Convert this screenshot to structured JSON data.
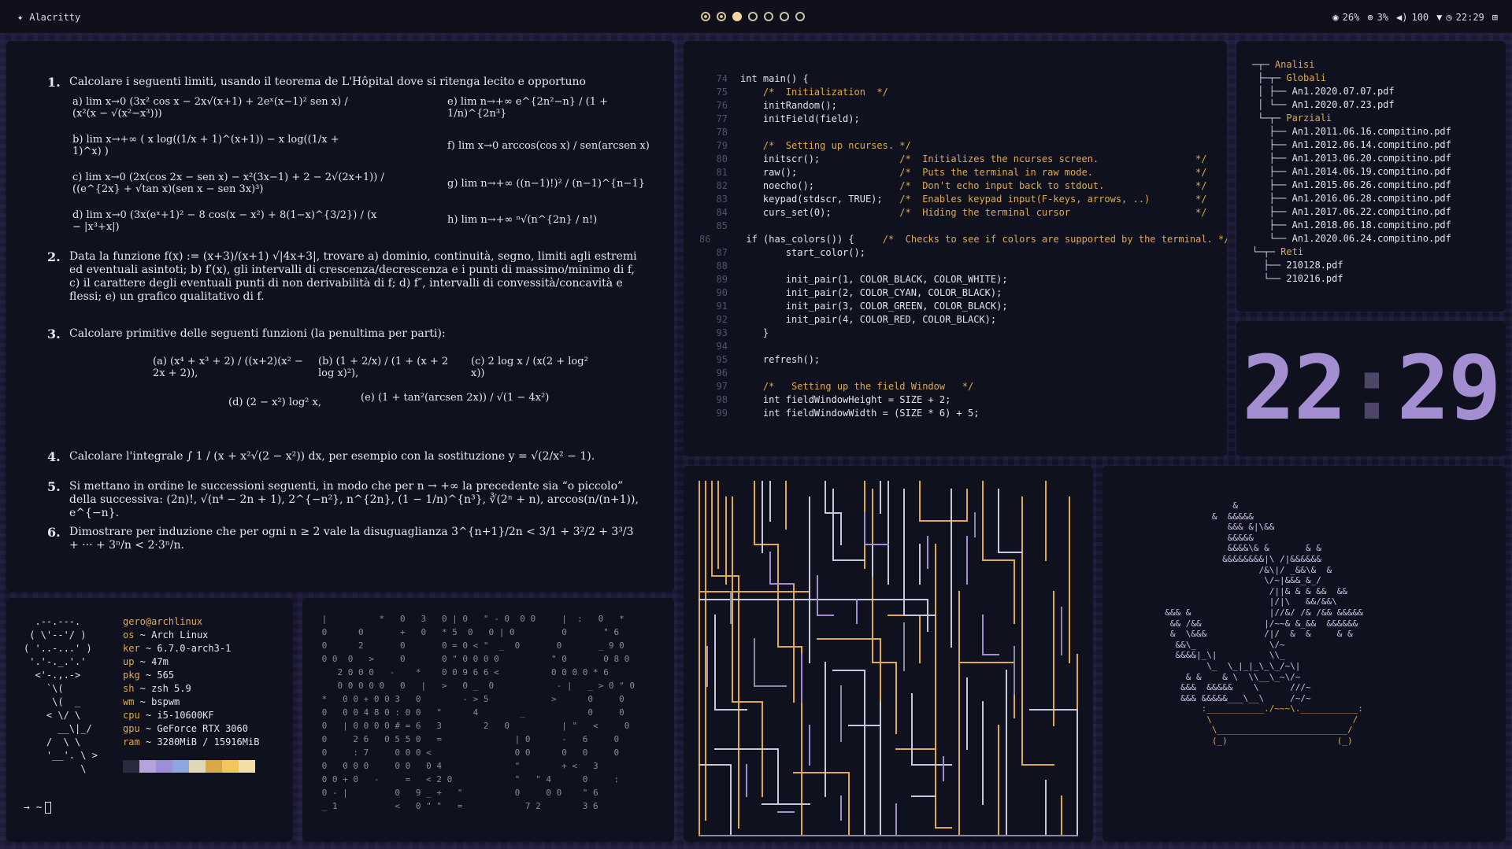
{
  "topbar": {
    "app_icon": "sparkle-icon",
    "app_title": "Alacritty",
    "workspaces": [
      "occupied",
      "occupied",
      "active",
      "empty",
      "empty",
      "empty",
      "empty"
    ],
    "cpu": "26%",
    "net": "3%",
    "volume": "100",
    "clock": "22:29"
  },
  "doc": {
    "q1_num": "1.",
    "q1_text": "Calcolare i seguenti limiti, usando il teorema de L'Hôpital dove si ritenga lecito e opportuno",
    "q1_a": "a) lim x→0  (3x² cos x − 2x√(x+1) + 2eˣ(x−1)² sen x) / (x²(x − √(x²−x³)))",
    "q1_b": "b) lim x→+∞ ( x log((1/x + 1)^(x+1)) − x log((1/x + 1)^x) )",
    "q1_c": "c) lim x→0  (2x(cos 2x − sen x) − x²(3x−1) + 2 − 2√(2x+1)) / ((e^{2x} + √tan x)(sen x − sen 3x)³)",
    "q1_d": "d) lim x→0  (3x(eˣ+1)² − 8 cos(x − x²) + 8(1−x)^{3/2}) / (x − |x³+x|)",
    "q1_e": "e) lim n→+∞  e^{2n²−n} / (1 + 1/n)^{2n³}",
    "q1_f": "f) lim x→0  arccos(cos x) / sen(arcsen x)",
    "q1_g": "g) lim n→+∞  ((n−1)!)² / (n−1)^{n−1}",
    "q1_h": "h) lim n→+∞  ⁿ√(n^{2n} / n!)",
    "q2_num": "2.",
    "q2_text": "Data la funzione f(x) := (x+3)/(x+1) √|4x+3|, trovare a) dominio, continuità, segno, limiti agli estremi ed eventuali asintoti; b) f′(x), gli intervalli di crescenza/decrescenza e i punti di massimo/minimo di f, c) il carattere degli eventuali punti di non derivabilità di f; d) f″, intervalli di convessità/concavità e flessi; e) un grafico qualitativo di f.",
    "q3_num": "3.",
    "q3_text": "Calcolare primitive delle seguenti funzioni (la penultima per parti):",
    "q3_a": "(a)  (x⁴ + x³ + 2) / ((x+2)(x² − 2x + 2)),",
    "q3_b": "(b)  (1 + 2/x) / (1 + (x + 2 log x)²),",
    "q3_c": "(c)  2 log x / (x(2 + log² x))",
    "q3_d": "(d)  (2 − x²) log² x,",
    "q3_e": "(e)  (1 + tan²(arcsen 2x)) / √(1 − 4x²)",
    "q4_num": "4.",
    "q4_text": "Calcolare l'integrale ∫ 1 / (x + x²√(2 − x²)) dx, per esempio con la sostituzione y = √(2/x² − 1).",
    "q5_num": "5.",
    "q5_text": "Si mettano in ordine le successioni seguenti, in modo che per n → +∞ la precedente sia “o piccolo” della successiva: (2n)!,  √(n⁴ − 2n + 1),  2^{−n²},  n^{2n},  (1 − 1/n)^{n³},  ∛(2ⁿ + n),  arccos(n/(n+1)),  e^{−n}.",
    "q6_num": "6.",
    "q6_text": "Dimostrare per induzione che per ogni n ≥ 2 vale la disuguaglianza 3^{n+1}/2n < 3/1 + 3²/2 + 3³/3 + ··· + 3ⁿ/n < 2·3ⁿ/n."
  },
  "code": {
    "lines": [
      {
        "no": "74",
        "text": "int main() {"
      },
      {
        "no": "75",
        "text": "    /*  Initialization  */"
      },
      {
        "no": "76",
        "text": "    initRandom();"
      },
      {
        "no": "77",
        "text": "    initField(field);"
      },
      {
        "no": "78",
        "text": ""
      },
      {
        "no": "79",
        "text": "    /*  Setting up ncurses. */"
      },
      {
        "no": "80",
        "text": "    initscr();              /*  Initializes the ncurses screen.                 */"
      },
      {
        "no": "81",
        "text": "    raw();                  /*  Puts the terminal in raw mode.                  */"
      },
      {
        "no": "82",
        "text": "    noecho();               /*  Don't echo input back to stdout.                */"
      },
      {
        "no": "83",
        "text": "    keypad(stdscr, TRUE);   /*  Enables keypad input(F-keys, arrows, ..)        */"
      },
      {
        "no": "84",
        "text": "    curs_set(0);            /*  Hiding the terminal cursor                      */"
      },
      {
        "no": "85",
        "text": ""
      },
      {
        "no": "86",
        "text": "    if (has_colors()) {     /*  Checks to see if colors are supported by the terminal. */"
      },
      {
        "no": "87",
        "text": "        start_color();"
      },
      {
        "no": "88",
        "text": ""
      },
      {
        "no": "89",
        "text": "        init_pair(1, COLOR_BLACK, COLOR_WHITE);"
      },
      {
        "no": "90",
        "text": "        init_pair(2, COLOR_CYAN, COLOR_BLACK);"
      },
      {
        "no": "91",
        "text": "        init_pair(3, COLOR_GREEN, COLOR_BLACK);"
      },
      {
        "no": "92",
        "text": "        init_pair(4, COLOR_RED, COLOR_BLACK);"
      },
      {
        "no": "93",
        "text": "    }"
      },
      {
        "no": "94",
        "text": ""
      },
      {
        "no": "95",
        "text": "    refresh();"
      },
      {
        "no": "96",
        "text": ""
      },
      {
        "no": "97",
        "text": "    /*   Setting up the field Window   */"
      },
      {
        "no": "98",
        "text": "    int fieldWindowHeight = SIZE + 2;"
      },
      {
        "no": "99",
        "text": "    int fieldWindowWidth = (SIZE * 6) + 5;"
      }
    ]
  },
  "tree": {
    "rows": [
      {
        "prefix": "─┬─ ",
        "name": "Analisi",
        "kind": "dir"
      },
      {
        "prefix": " ├─┬─ ",
        "name": "Globali",
        "kind": "dir"
      },
      {
        "prefix": " │ ├── ",
        "name": "An1.2020.07.07.pdf",
        "kind": "file"
      },
      {
        "prefix": " │ └── ",
        "name": "An1.2020.07.23.pdf",
        "kind": "file"
      },
      {
        "prefix": " └─┬─ ",
        "name": "Parziali",
        "kind": "dir"
      },
      {
        "prefix": "   ├── ",
        "name": "An1.2011.06.16.compitino.pdf",
        "kind": "file"
      },
      {
        "prefix": "   ├── ",
        "name": "An1.2012.06.14.compitino.pdf",
        "kind": "file"
      },
      {
        "prefix": "   ├── ",
        "name": "An1.2013.06.20.compitino.pdf",
        "kind": "file"
      },
      {
        "prefix": "   ├── ",
        "name": "An1.2014.06.19.compitino.pdf",
        "kind": "file"
      },
      {
        "prefix": "   ├── ",
        "name": "An1.2015.06.26.compitino.pdf",
        "kind": "file"
      },
      {
        "prefix": "   ├── ",
        "name": "An1.2016.06.28.compitino.pdf",
        "kind": "file"
      },
      {
        "prefix": "   ├── ",
        "name": "An1.2017.06.22.compitino.pdf",
        "kind": "file"
      },
      {
        "prefix": "   ├── ",
        "name": "An1.2018.06.18.compitino.pdf",
        "kind": "file"
      },
      {
        "prefix": "   └── ",
        "name": "An1.2020.06.24.compitino.pdf",
        "kind": "file"
      },
      {
        "prefix": "└─┬─ ",
        "name": "Reti",
        "kind": "dir"
      },
      {
        "prefix": "  ├── ",
        "name": "210128.pdf",
        "kind": "file"
      },
      {
        "prefix": "  └── ",
        "name": "210216.pdf",
        "kind": "file"
      }
    ]
  },
  "clock_big": {
    "hh": "22",
    "sep": ":",
    "mm": "29"
  },
  "fetch": {
    "art": "  .--.---.\n ( \\'--'/ )\n( '..-...' )\n '.'-._.'.'\n  <'-.,.->\n    `\\(\n     \\(  _\n    < \\/ \\\n      __\\|_/\n    /  \\ \\\n    '__'. \\ >\n          \\",
    "user": "gero@archlinux",
    "rows": [
      {
        "k": "os",
        "v": "Arch Linux"
      },
      {
        "k": "ker",
        "v": "6.7.0-arch3-1"
      },
      {
        "k": "up",
        "v": "47m"
      },
      {
        "k": "pkg",
        "v": "565"
      },
      {
        "k": "sh",
        "v": "zsh 5.9"
      },
      {
        "k": "wm",
        "v": "bspwm"
      },
      {
        "k": "cpu",
        "v": "i5-10600KF"
      },
      {
        "k": "gpu",
        "v": "GeForce RTX 3060"
      },
      {
        "k": "ram",
        "v": "3280MiB / 15916MiB"
      }
    ],
    "swatch": [
      "#2a2a3e",
      "#b6a3dc",
      "#9b8fd6",
      "#8ea6e0",
      "#e0d7b8",
      "#d7a848",
      "#f2c55e",
      "#f3dea8"
    ],
    "prompt": "→ ~"
  },
  "matrix": {
    "rows": [
      " |          *   0   3   0 | 0   \" - 0  0 0     |  :   0   *",
      " 0      0       +   0   * 5  0   0 | 0         0       \" 6",
      " 0      2       0       0 = 0 < \"  _  0       0       _ 9 0",
      " 0 0  0   >     0       0 \" 0 0 0 0          \" 0       0 8 0",
      "    2 0 0 0   -    *    0 0 9 6 6 <          0 0 0 0 * 6",
      "    0 0 0 0 0   0   |   >   0 _  0            - |   _ > 0 \" 0",
      " *   0 0 + 0 0 3   0        - > 5            >      0     0",
      " 0   0 0 4 8 0 : 0 0   \"      4        _            0     0",
      " 0   | 0 0 0 0 # = 6   3        2   0          | \"   <     0",
      " 0     2 6   0 5 5 0   =              | 0      -   6     0",
      " 0     : 7     0 0 0 <                0 0      0   0     0",
      " 0   0 0 0     0 0   0 4              \"        + <   3",
      " 0 0 + 0   -     =   < 2 0            \"   \" 4      0     :",
      " 0 - |         0   9 _ +   \"          0     0 0    \" 6",
      " _ 1           <   0 \" \"   =            7 2        3 6"
    ]
  },
  "bonsai": {
    "art": "               &\n           &  &&&&&\n              &&& &|\\&&\n              &&&&&\n              &&&&\\& &       & &\n             &&&&&&&&|\\ /|&&&&&&\n                    /&\\|/ _&&\\&  &\n                     \\/~|&&&_&_/\n                      /||& & & &&  &&\n                      |/|\\   &&/&&\\\n  &&& &               |//&/ /& /&& &&&&&\n   && /&&            |/~~& &_&&  &&&&&&\n   &  \\&&&           /|/  &  &     & &\n    &&\\_              \\/~\n    &&&&|_\\|          \\\\_\n          \\_  \\_|_|_\\_\\_/~\\|\n      & &    & \\  \\\\__\\_~\\/~\n     &&&  &&&&&    \\      ///~\n     &&& &&&&&___\\__\\     /~/~",
    "pot": "         :___________./~~~\\.___________:\n          \\                           /\n           \\_________________________/\n           (_)                     (_)"
  }
}
